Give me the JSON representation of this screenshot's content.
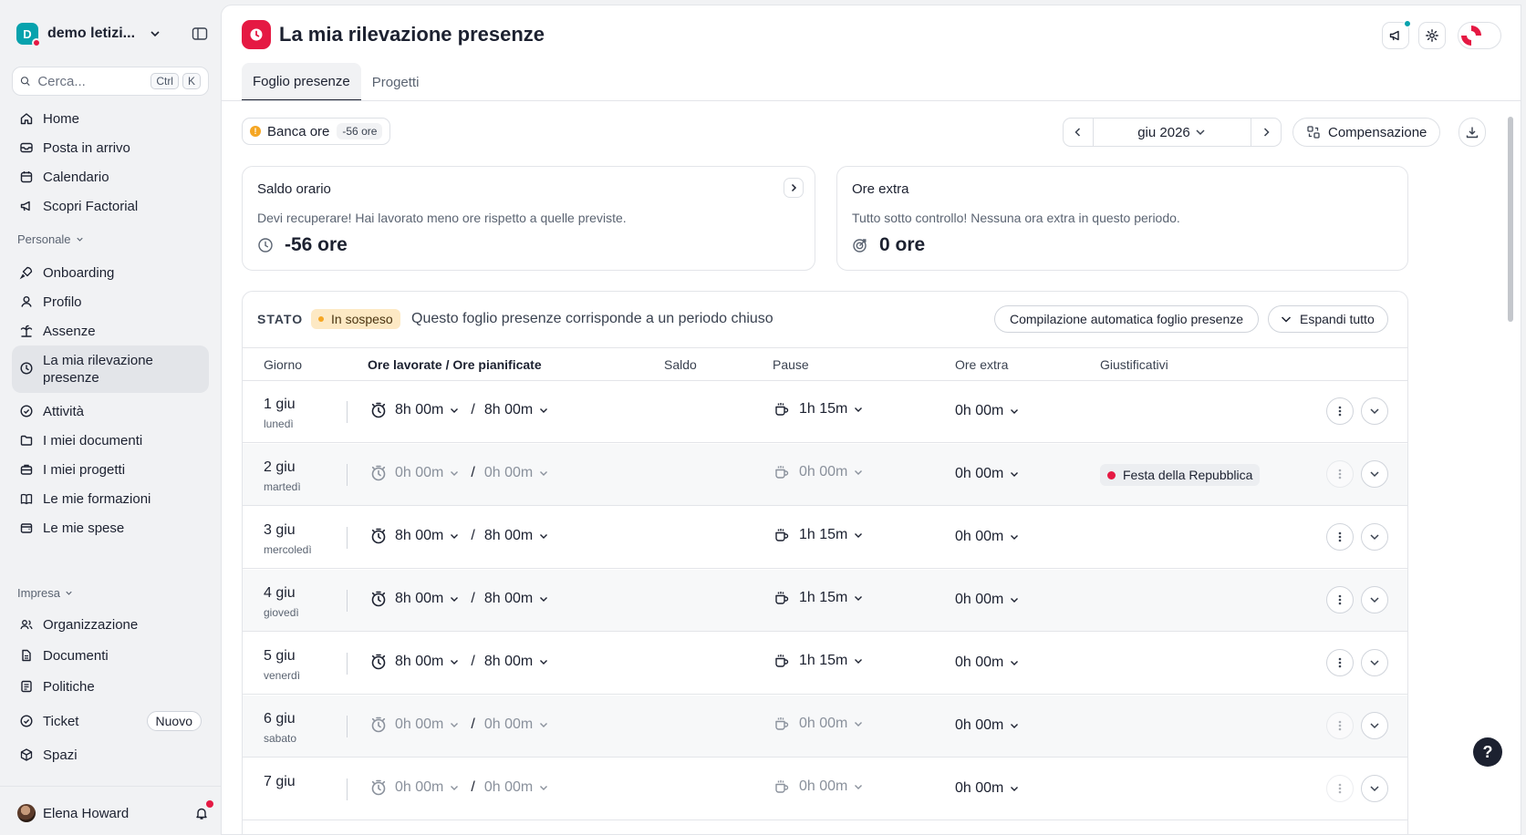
{
  "workspace": {
    "initial": "D",
    "name": "demo letizi..."
  },
  "search": {
    "placeholder": "Cerca...",
    "key1": "Ctrl",
    "key2": "K"
  },
  "nav_main": [
    {
      "label": "Home",
      "icon": "home-icon"
    },
    {
      "label": "Posta in arrivo",
      "icon": "inbox-icon"
    },
    {
      "label": "Calendario",
      "icon": "calendar-icon"
    },
    {
      "label": "Scopri Factorial",
      "icon": "megaphone-icon"
    }
  ],
  "sections": {
    "personal": "Personale",
    "company": "Impresa"
  },
  "nav_personal": [
    {
      "label": "Onboarding",
      "icon": "rocket-icon"
    },
    {
      "label": "Profilo",
      "icon": "person-icon"
    },
    {
      "label": "Assenze",
      "icon": "palm-icon"
    },
    {
      "label": "La mia rilevazione presenze",
      "icon": "clock-icon"
    },
    {
      "label": "Attività",
      "icon": "check-circle-icon"
    },
    {
      "label": "I miei documenti",
      "icon": "folder-icon"
    },
    {
      "label": "I miei progetti",
      "icon": "briefcase-icon"
    },
    {
      "label": "Le mie formazioni",
      "icon": "book-icon"
    },
    {
      "label": "Le mie spese",
      "icon": "wallet-icon"
    }
  ],
  "nav_company": [
    {
      "label": "Organizzazione",
      "icon": "people-icon"
    },
    {
      "label": "Documenti",
      "icon": "document-icon"
    },
    {
      "label": "Politiche",
      "icon": "policy-icon"
    },
    {
      "label": "Ticket",
      "icon": "ticket-icon",
      "badge": "Nuovo"
    },
    {
      "label": "Spazi",
      "icon": "cube-icon"
    }
  ],
  "user": {
    "name": "Elena Howard"
  },
  "page": {
    "title": "La mia rilevazione presenze"
  },
  "tabs": [
    {
      "label": "Foglio presenze"
    },
    {
      "label": "Progetti"
    }
  ],
  "bank": {
    "label": "Banca ore",
    "value": "-56 ore"
  },
  "period": {
    "label": "giu 2026"
  },
  "compensation": {
    "label": "Compensazione"
  },
  "cards": {
    "balance": {
      "title": "Saldo orario",
      "desc": "Devi recuperare! Hai lavorato meno ore rispetto a quelle previste.",
      "value": "-56 ore"
    },
    "extra": {
      "title": "Ore extra",
      "desc": "Tutto sotto controllo! Nessuna ora extra in questo periodo.",
      "value": "0 ore"
    }
  },
  "sheet": {
    "status_label": "STATO",
    "status_value": "In sospeso",
    "closed_text": "Questo foglio presenze corrisponde a un periodo chiuso",
    "auto_fill": "Compilazione automatica foglio presenze",
    "expand_all": "Espandi tutto",
    "columns": {
      "day": "Giorno",
      "worked": "Ore lavorate / Ore pianificate",
      "balance": "Saldo",
      "pause": "Pause",
      "extra": "Ore extra",
      "justif": "Giustificativi"
    },
    "rows": [
      {
        "day": "1 giu",
        "weekday": "lunedì",
        "worked": "8h 00m",
        "planned": "8h 00m",
        "pause": "1h 15m",
        "extra": "0h 00m",
        "justif": "",
        "off": false
      },
      {
        "day": "2 giu",
        "weekday": "martedì",
        "worked": "0h 00m",
        "planned": "0h 00m",
        "pause": "0h 00m",
        "extra": "0h 00m",
        "justif": "Festa della Repubblica",
        "off": true
      },
      {
        "day": "3 giu",
        "weekday": "mercoledì",
        "worked": "8h 00m",
        "planned": "8h 00m",
        "pause": "1h 15m",
        "extra": "0h 00m",
        "justif": "",
        "off": false
      },
      {
        "day": "4 giu",
        "weekday": "giovedì",
        "worked": "8h 00m",
        "planned": "8h 00m",
        "pause": "1h 15m",
        "extra": "0h 00m",
        "justif": "",
        "off": false
      },
      {
        "day": "5 giu",
        "weekday": "venerdì",
        "worked": "8h 00m",
        "planned": "8h 00m",
        "pause": "1h 15m",
        "extra": "0h 00m",
        "justif": "",
        "off": false
      },
      {
        "day": "6 giu",
        "weekday": "sabato",
        "worked": "0h 00m",
        "planned": "0h 00m",
        "pause": "0h 00m",
        "extra": "0h 00m",
        "justif": "",
        "off": true
      },
      {
        "day": "7 giu",
        "weekday": "",
        "worked": "0h 00m",
        "planned": "0h 00m",
        "pause": "0h 00m",
        "extra": "0h 00m",
        "justif": "",
        "off": true
      }
    ]
  },
  "help": {
    "label": "?"
  },
  "colors": {
    "accent": "#e51943",
    "brand": "#07a2ad",
    "pending": "#fde9c4",
    "text": "#1c2130"
  }
}
